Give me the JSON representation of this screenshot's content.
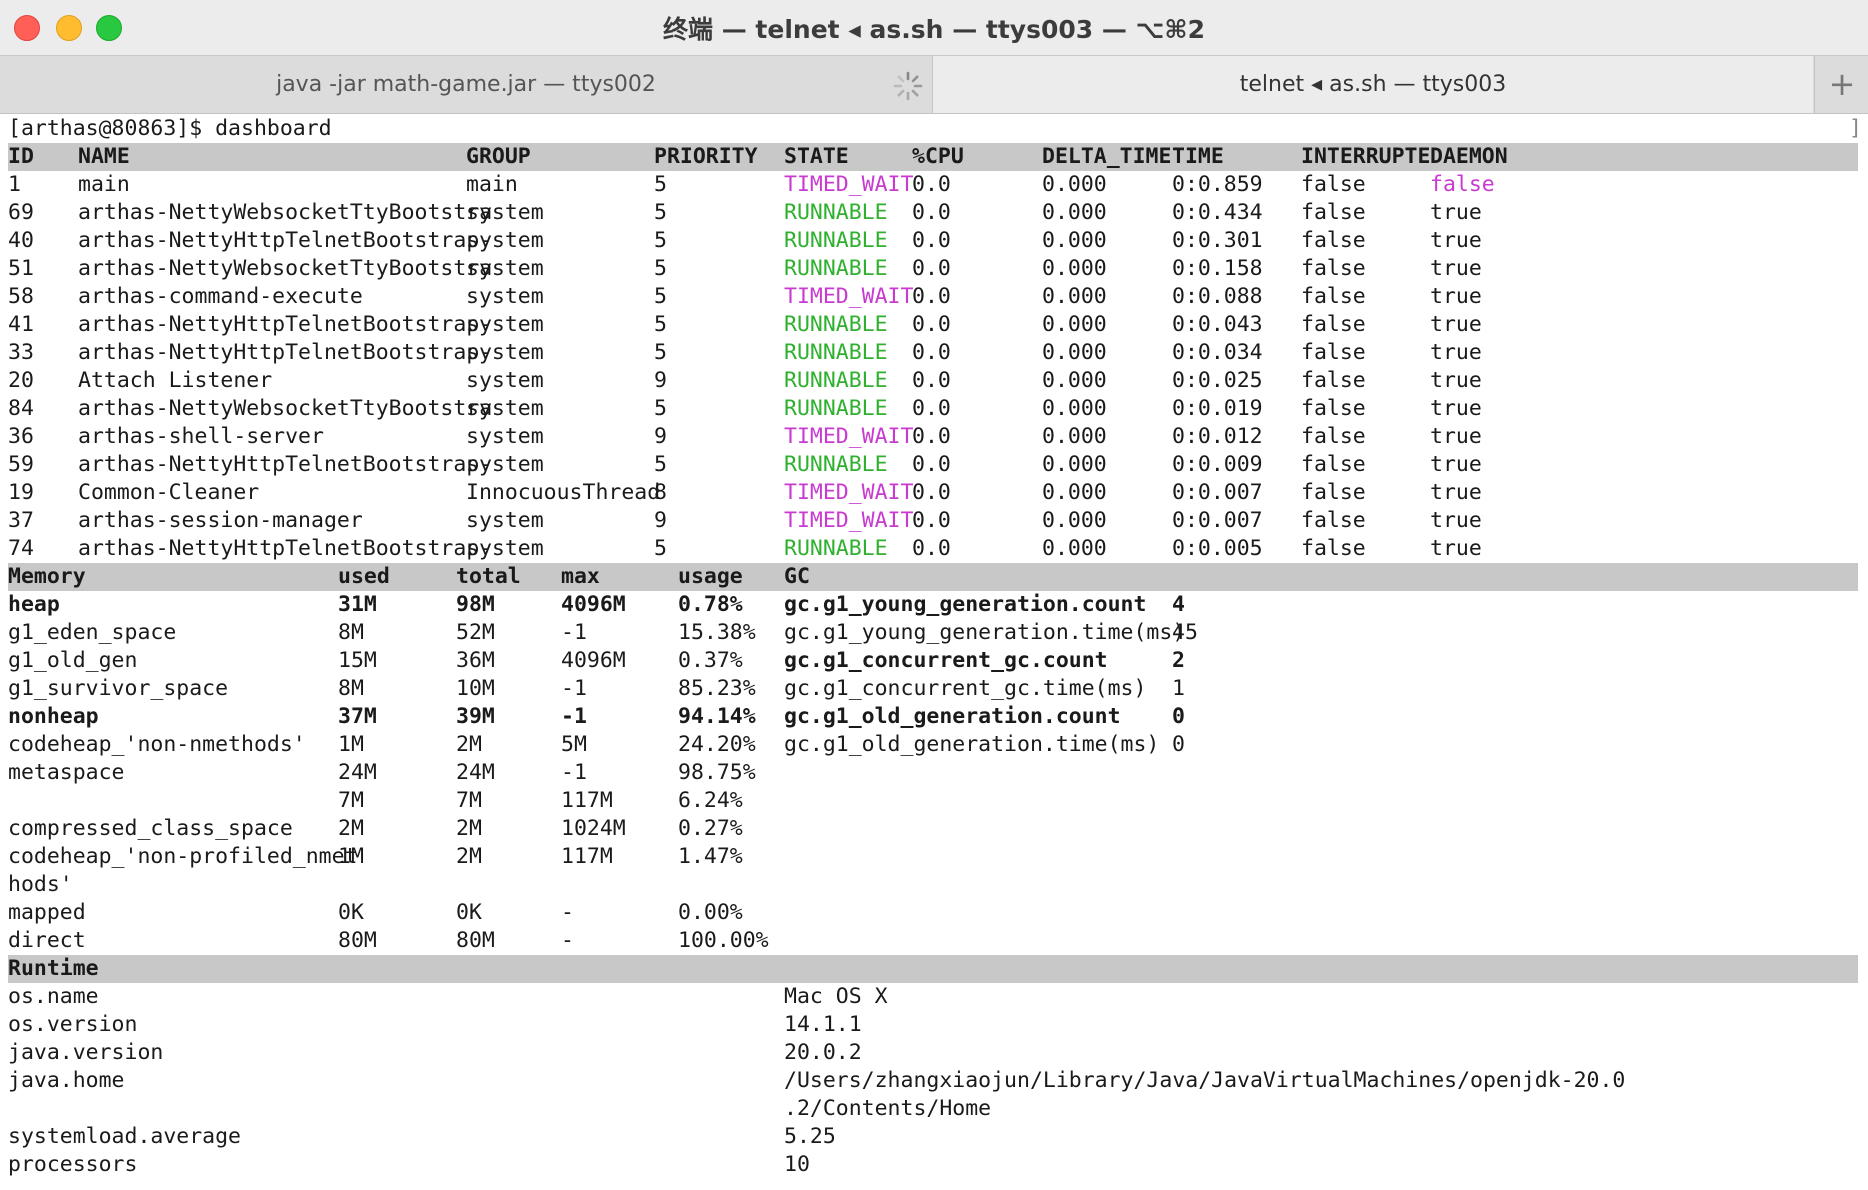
{
  "window": {
    "title": "终端 — telnet ◂ as.sh — ttys003 — ⌥⌘2",
    "tabs": [
      {
        "label": "java -jar math-game.jar — ttys002"
      },
      {
        "label": "telnet ◂ as.sh — ttys003"
      }
    ],
    "new_tab_symbol": "+"
  },
  "prompt": {
    "text": "[arthas@80863]$ dashboard",
    "right_bracket": "]"
  },
  "threads": {
    "headers": [
      "ID",
      "NAME",
      "GROUP",
      "PRIORITY",
      "STATE",
      "%CPU",
      "DELTA_TIME",
      "TIME",
      "INTERRUPTE",
      "DAEMON"
    ],
    "rows": [
      {
        "id": "1",
        "name": "main",
        "group": "main",
        "priority": "5",
        "state": "TIMED_WAIT",
        "cpu": "0.0",
        "delta": "0.000",
        "time": "0:0.859",
        "interrupted": "false",
        "daemon": "false"
      },
      {
        "id": "69",
        "name": "arthas-NettyWebsocketTtyBootstra",
        "group": "system",
        "priority": "5",
        "state": "RUNNABLE",
        "cpu": "0.0",
        "delta": "0.000",
        "time": "0:0.434",
        "interrupted": "false",
        "daemon": "true"
      },
      {
        "id": "40",
        "name": "arthas-NettyHttpTelnetBootstrap-",
        "group": "system",
        "priority": "5",
        "state": "RUNNABLE",
        "cpu": "0.0",
        "delta": "0.000",
        "time": "0:0.301",
        "interrupted": "false",
        "daemon": "true"
      },
      {
        "id": "51",
        "name": "arthas-NettyWebsocketTtyBootstra",
        "group": "system",
        "priority": "5",
        "state": "RUNNABLE",
        "cpu": "0.0",
        "delta": "0.000",
        "time": "0:0.158",
        "interrupted": "false",
        "daemon": "true"
      },
      {
        "id": "58",
        "name": "arthas-command-execute",
        "group": "system",
        "priority": "5",
        "state": "TIMED_WAIT",
        "cpu": "0.0",
        "delta": "0.000",
        "time": "0:0.088",
        "interrupted": "false",
        "daemon": "true"
      },
      {
        "id": "41",
        "name": "arthas-NettyHttpTelnetBootstrap-",
        "group": "system",
        "priority": "5",
        "state": "RUNNABLE",
        "cpu": "0.0",
        "delta": "0.000",
        "time": "0:0.043",
        "interrupted": "false",
        "daemon": "true"
      },
      {
        "id": "33",
        "name": "arthas-NettyHttpTelnetBootstrap-",
        "group": "system",
        "priority": "5",
        "state": "RUNNABLE",
        "cpu": "0.0",
        "delta": "0.000",
        "time": "0:0.034",
        "interrupted": "false",
        "daemon": "true"
      },
      {
        "id": "20",
        "name": "Attach Listener",
        "group": "system",
        "priority": "9",
        "state": "RUNNABLE",
        "cpu": "0.0",
        "delta": "0.000",
        "time": "0:0.025",
        "interrupted": "false",
        "daemon": "true"
      },
      {
        "id": "84",
        "name": "arthas-NettyWebsocketTtyBootstra",
        "group": "system",
        "priority": "5",
        "state": "RUNNABLE",
        "cpu": "0.0",
        "delta": "0.000",
        "time": "0:0.019",
        "interrupted": "false",
        "daemon": "true"
      },
      {
        "id": "36",
        "name": "arthas-shell-server",
        "group": "system",
        "priority": "9",
        "state": "TIMED_WAIT",
        "cpu": "0.0",
        "delta": "0.000",
        "time": "0:0.012",
        "interrupted": "false",
        "daemon": "true"
      },
      {
        "id": "59",
        "name": "arthas-NettyHttpTelnetBootstrap-",
        "group": "system",
        "priority": "5",
        "state": "RUNNABLE",
        "cpu": "0.0",
        "delta": "0.000",
        "time": "0:0.009",
        "interrupted": "false",
        "daemon": "true"
      },
      {
        "id": "19",
        "name": "Common-Cleaner",
        "group": "InnocuousThread",
        "priority": "8",
        "state": "TIMED_WAIT",
        "cpu": "0.0",
        "delta": "0.000",
        "time": "0:0.007",
        "interrupted": "false",
        "daemon": "true"
      },
      {
        "id": "37",
        "name": "arthas-session-manager",
        "group": "system",
        "priority": "9",
        "state": "TIMED_WAIT",
        "cpu": "0.0",
        "delta": "0.000",
        "time": "0:0.007",
        "interrupted": "false",
        "daemon": "true"
      },
      {
        "id": "74",
        "name": "arthas-NettyHttpTelnetBootstrap-",
        "group": "system",
        "priority": "5",
        "state": "RUNNABLE",
        "cpu": "0.0",
        "delta": "0.000",
        "time": "0:0.005",
        "interrupted": "false",
        "daemon": "true"
      }
    ]
  },
  "memory": {
    "headers": [
      "Memory",
      "used",
      "total",
      "max",
      "usage",
      "GC"
    ],
    "rows": [
      {
        "name": "heap",
        "used": "31M",
        "total": "98M",
        "max": "4096M",
        "usage": "0.78%",
        "bold": true
      },
      {
        "name": "g1_eden_space",
        "used": "8M",
        "total": "52M",
        "max": "-1",
        "usage": "15.38%",
        "bold": false
      },
      {
        "name": "g1_old_gen",
        "used": "15M",
        "total": "36M",
        "max": "4096M",
        "usage": "0.37%",
        "bold": false
      },
      {
        "name": "g1_survivor_space",
        "used": "8M",
        "total": "10M",
        "max": "-1",
        "usage": "85.23%",
        "bold": false
      },
      {
        "name": "nonheap",
        "used": "37M",
        "total": "39M",
        "max": "-1",
        "usage": "94.14%",
        "bold": true
      },
      {
        "name": "codeheap_'non-nmethods'",
        "used": "1M",
        "total": "2M",
        "max": "5M",
        "usage": "24.20%",
        "bold": false
      },
      {
        "name": "metaspace",
        "used": "24M",
        "total": "24M",
        "max": "-1",
        "usage": "98.75%",
        "bold": false
      },
      {
        "name": "",
        "used": "7M",
        "total": "7M",
        "max": "117M",
        "usage": "6.24%",
        "bold": false
      },
      {
        "name": "compressed_class_space",
        "used": "2M",
        "total": "2M",
        "max": "1024M",
        "usage": "0.27%",
        "bold": false
      },
      {
        "name": "codeheap_'non-profiled_nmet",
        "used": "1M",
        "total": "2M",
        "max": "117M",
        "usage": "1.47%",
        "bold": false
      },
      {
        "name": "hods'",
        "used": "",
        "total": "",
        "max": "",
        "usage": "",
        "bold": false
      },
      {
        "name": "mapped",
        "used": "0K",
        "total": "0K",
        "max": "-",
        "usage": "0.00%",
        "bold": false
      },
      {
        "name": "direct",
        "used": "80M",
        "total": "80M",
        "max": "-",
        "usage": "100.00%",
        "bold": false
      }
    ],
    "gc": [
      {
        "key": "gc.g1_young_generation.count",
        "value": "4",
        "bold": true
      },
      {
        "key": "gc.g1_young_generation.time(ms)",
        "value": "45",
        "bold": false
      },
      {
        "key": "gc.g1_concurrent_gc.count",
        "value": "2",
        "bold": true
      },
      {
        "key": "gc.g1_concurrent_gc.time(ms)",
        "value": "1",
        "bold": false
      },
      {
        "key": "gc.g1_old_generation.count",
        "value": "0",
        "bold": true
      },
      {
        "key": "gc.g1_old_generation.time(ms)",
        "value": "0",
        "bold": false
      }
    ]
  },
  "runtime": {
    "header": "Runtime",
    "rows": [
      {
        "key": "os.name",
        "value": "Mac OS X"
      },
      {
        "key": "os.version",
        "value": "14.1.1"
      },
      {
        "key": "java.version",
        "value": "20.0.2"
      },
      {
        "key": "java.home",
        "value": "/Users/zhangxiaojun/Library/Java/JavaVirtualMachines/openjdk-20.0"
      },
      {
        "key": "",
        "value": ".2/Contents/Home"
      },
      {
        "key": "systemload.average",
        "value": "5.25"
      },
      {
        "key": "processors",
        "value": "10"
      }
    ]
  },
  "colors": {
    "runnable": "#2fb02f",
    "timed_wait": "#c83ad0",
    "false_daemon": "#c83ad0",
    "section_bar": "#c8c8c8"
  }
}
